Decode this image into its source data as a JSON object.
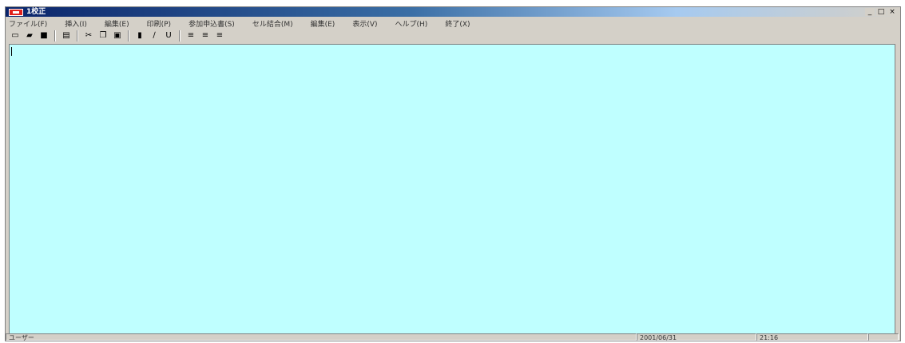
{
  "window": {
    "title": "1校正",
    "controls": [
      "_",
      "□",
      "×"
    ]
  },
  "menu": {
    "items": [
      "ファイル(F)",
      "挿入(I)",
      "編集(E)",
      "印刷(P)",
      "参加申込書(S)",
      "セル結合(M)",
      "編集(E)",
      "表示(V)",
      "ヘルプ(H)",
      "終了(X)"
    ]
  },
  "toolbar": {
    "icons": [
      {
        "name": "new-document-icon",
        "glyph": "▭"
      },
      {
        "name": "open-folder-icon",
        "glyph": "▰"
      },
      {
        "name": "save-icon",
        "glyph": "■"
      },
      {
        "name": "print-icon",
        "glyph": "▤"
      },
      {
        "name": "cut-icon",
        "glyph": "✂"
      },
      {
        "name": "copy-icon",
        "glyph": "❐"
      },
      {
        "name": "paste-icon",
        "glyph": "▣"
      },
      {
        "name": "bold-icon",
        "glyph": "▮"
      },
      {
        "name": "italic-icon",
        "glyph": "∕"
      },
      {
        "name": "underline-icon",
        "glyph": "U"
      },
      {
        "name": "align-left-icon",
        "glyph": "≡"
      },
      {
        "name": "align-center-icon",
        "glyph": "≡"
      },
      {
        "name": "align-right-icon",
        "glyph": "≡"
      }
    ]
  },
  "status": {
    "mode": "ユーザー",
    "date": "2001/06/31",
    "time": "21:16"
  },
  "colors": {
    "editor_background": "#bfffff",
    "title_gradient_start": "#0a246a",
    "app_icon": "#e0201b"
  }
}
